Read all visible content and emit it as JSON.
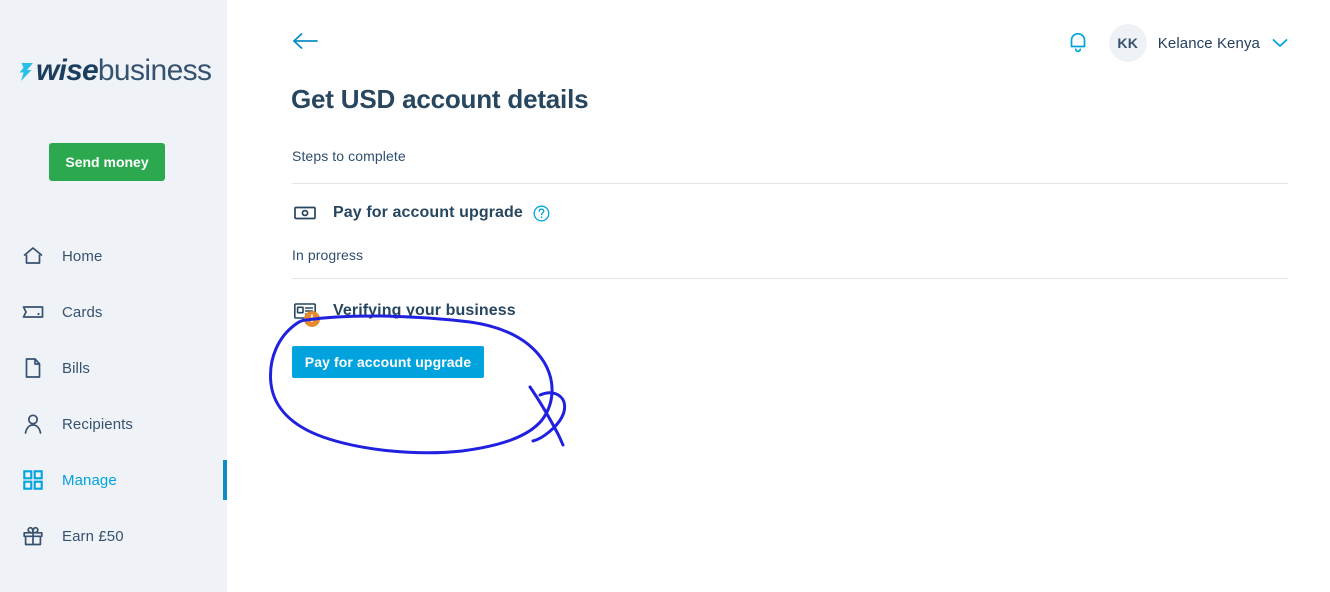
{
  "brand": {
    "mark_icon": "wise-arrow-icon",
    "name_bold": "wise",
    "name_light": "business"
  },
  "sidebar": {
    "background_color": "#eff3f8",
    "send_money_label": "Send money",
    "send_money_color": "#2ca94f",
    "active_indicator_color": "#0d8dc4",
    "items": [
      {
        "label": "Home",
        "icon": "house-icon",
        "active": false
      },
      {
        "label": "Cards",
        "icon": "card-icon",
        "active": false
      },
      {
        "label": "Bills",
        "icon": "document-icon",
        "active": false
      },
      {
        "label": "Recipients",
        "icon": "person-icon",
        "active": false
      },
      {
        "label": "Manage",
        "icon": "grid-icon",
        "active": true
      },
      {
        "label": "Earn £50",
        "icon": "gift-icon",
        "active": false
      }
    ]
  },
  "topbar": {
    "bell_icon": "bell-icon",
    "avatar_initials": "KK",
    "user_name": "Kelance Kenya",
    "chevron_icon": "chevron-down-icon",
    "accent_color": "#00a3dd"
  },
  "main": {
    "back_icon": "arrow-left-icon",
    "page_title": "Get USD account details",
    "steps_label": "Steps to complete",
    "steps": [
      {
        "icon": "banknote-icon",
        "title": "Pay for account upgrade",
        "help_icon": "question-circle-icon",
        "status": "In progress",
        "has_warning_badge": false
      },
      {
        "icon": "id-card-icon",
        "title": "Verifying your business",
        "help_icon": null,
        "status": null,
        "has_warning_badge": true,
        "warning_badge_text": "!",
        "warning_badge_color": "#e58b2e"
      }
    ],
    "primary_button": {
      "label": "Pay for account upgrade",
      "color": "#00a3dd"
    }
  },
  "annotation": {
    "type": "hand-drawn-circle",
    "color": "#2020e0",
    "stroke_width": 3,
    "describes": "circles the Pay for account upgrade button"
  }
}
